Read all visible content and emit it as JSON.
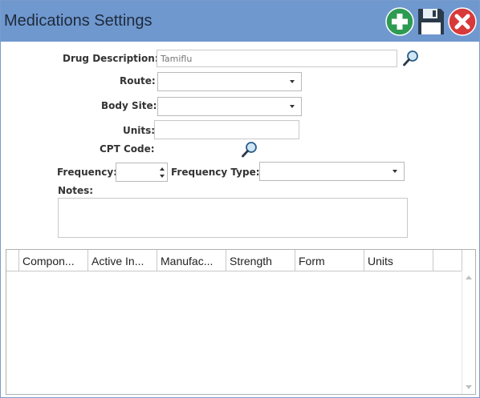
{
  "window": {
    "title": "Medications Settings"
  },
  "toolbar": {
    "add_icon": "plus-circle-icon",
    "save_icon": "floppy-disk-icon",
    "close_icon": "close-circle-icon",
    "colors": {
      "add": "#2e9b52",
      "save": "#2b3a4a",
      "close": "#d83a3a"
    }
  },
  "form": {
    "drug_description": {
      "label": "Drug Description:",
      "placeholder": "Tamiflu",
      "value": ""
    },
    "route": {
      "label": "Route:",
      "value": ""
    },
    "body_site": {
      "label": "Body Site:",
      "value": ""
    },
    "units": {
      "label": "Units:",
      "value": ""
    },
    "cpt_code": {
      "label": "CPT Code:"
    },
    "frequency": {
      "label": "Frequency:",
      "value": ""
    },
    "frequency_type": {
      "label": "Frequency Type:",
      "value": ""
    },
    "notes": {
      "label": "Notes:",
      "value": ""
    }
  },
  "grid": {
    "columns": [
      "Compon...",
      "Active In...",
      "Manufac...",
      "Strength",
      "Form",
      "Units"
    ],
    "rows": []
  }
}
